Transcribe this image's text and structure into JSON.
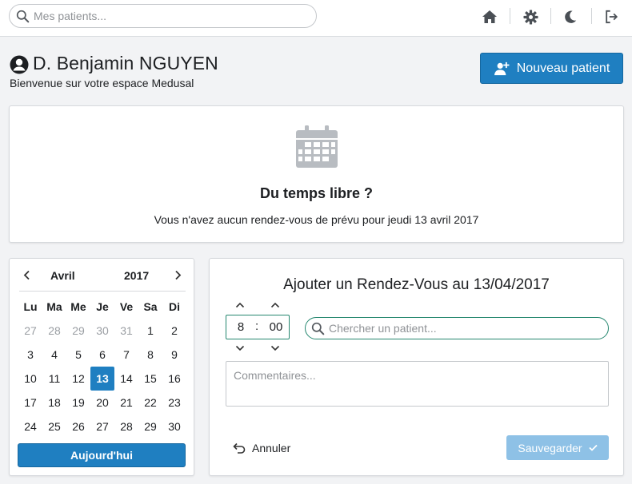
{
  "topbar": {
    "search_placeholder": "Mes patients...",
    "icons": [
      "search-icon",
      "home-icon",
      "gear-icon",
      "moon-icon",
      "logout-icon"
    ]
  },
  "header": {
    "doctor_name": "D. Benjamin NGUYEN",
    "welcome": "Bienvenue sur votre espace Medusal",
    "new_patient_label": "Nouveau patient"
  },
  "empty_state": {
    "title": "Du temps libre ?",
    "subtitle": "Vous n'avez aucun rendez-vous de prévu pour jeudi 13 avril 2017"
  },
  "calendar": {
    "month": "Avril",
    "year": "2017",
    "weekdays": [
      "Lu",
      "Ma",
      "Me",
      "Je",
      "Ve",
      "Sa",
      "Di"
    ],
    "weeks": [
      [
        {
          "d": "27",
          "m": true
        },
        {
          "d": "28",
          "m": true
        },
        {
          "d": "29",
          "m": true
        },
        {
          "d": "30",
          "m": true
        },
        {
          "d": "31",
          "m": true
        },
        {
          "d": "1"
        },
        {
          "d": "2"
        }
      ],
      [
        {
          "d": "3"
        },
        {
          "d": "4"
        },
        {
          "d": "5"
        },
        {
          "d": "6"
        },
        {
          "d": "7"
        },
        {
          "d": "8"
        },
        {
          "d": "9"
        }
      ],
      [
        {
          "d": "10"
        },
        {
          "d": "11"
        },
        {
          "d": "12"
        },
        {
          "d": "13",
          "sel": true
        },
        {
          "d": "14"
        },
        {
          "d": "15"
        },
        {
          "d": "16"
        }
      ],
      [
        {
          "d": "17"
        },
        {
          "d": "18"
        },
        {
          "d": "19"
        },
        {
          "d": "20"
        },
        {
          "d": "21"
        },
        {
          "d": "22"
        },
        {
          "d": "23"
        }
      ],
      [
        {
          "d": "24"
        },
        {
          "d": "25"
        },
        {
          "d": "26"
        },
        {
          "d": "27"
        },
        {
          "d": "28"
        },
        {
          "d": "29"
        },
        {
          "d": "30"
        }
      ]
    ],
    "today_label": "Aujourd'hui"
  },
  "appointment": {
    "title": "Ajouter un Rendez-Vous au 13/04/2017",
    "hour": "8",
    "separator": ":",
    "minute": "00",
    "patient_placeholder": "Chercher un patient...",
    "comments_placeholder": "Commentaires...",
    "cancel_label": "Annuler",
    "save_label": "Sauvegarder"
  },
  "colors": {
    "primary": "#1f7fc1",
    "primary_disabled": "#8ec1e6",
    "focus_border": "#25876f",
    "icon_gray": "#b8bcc1"
  }
}
